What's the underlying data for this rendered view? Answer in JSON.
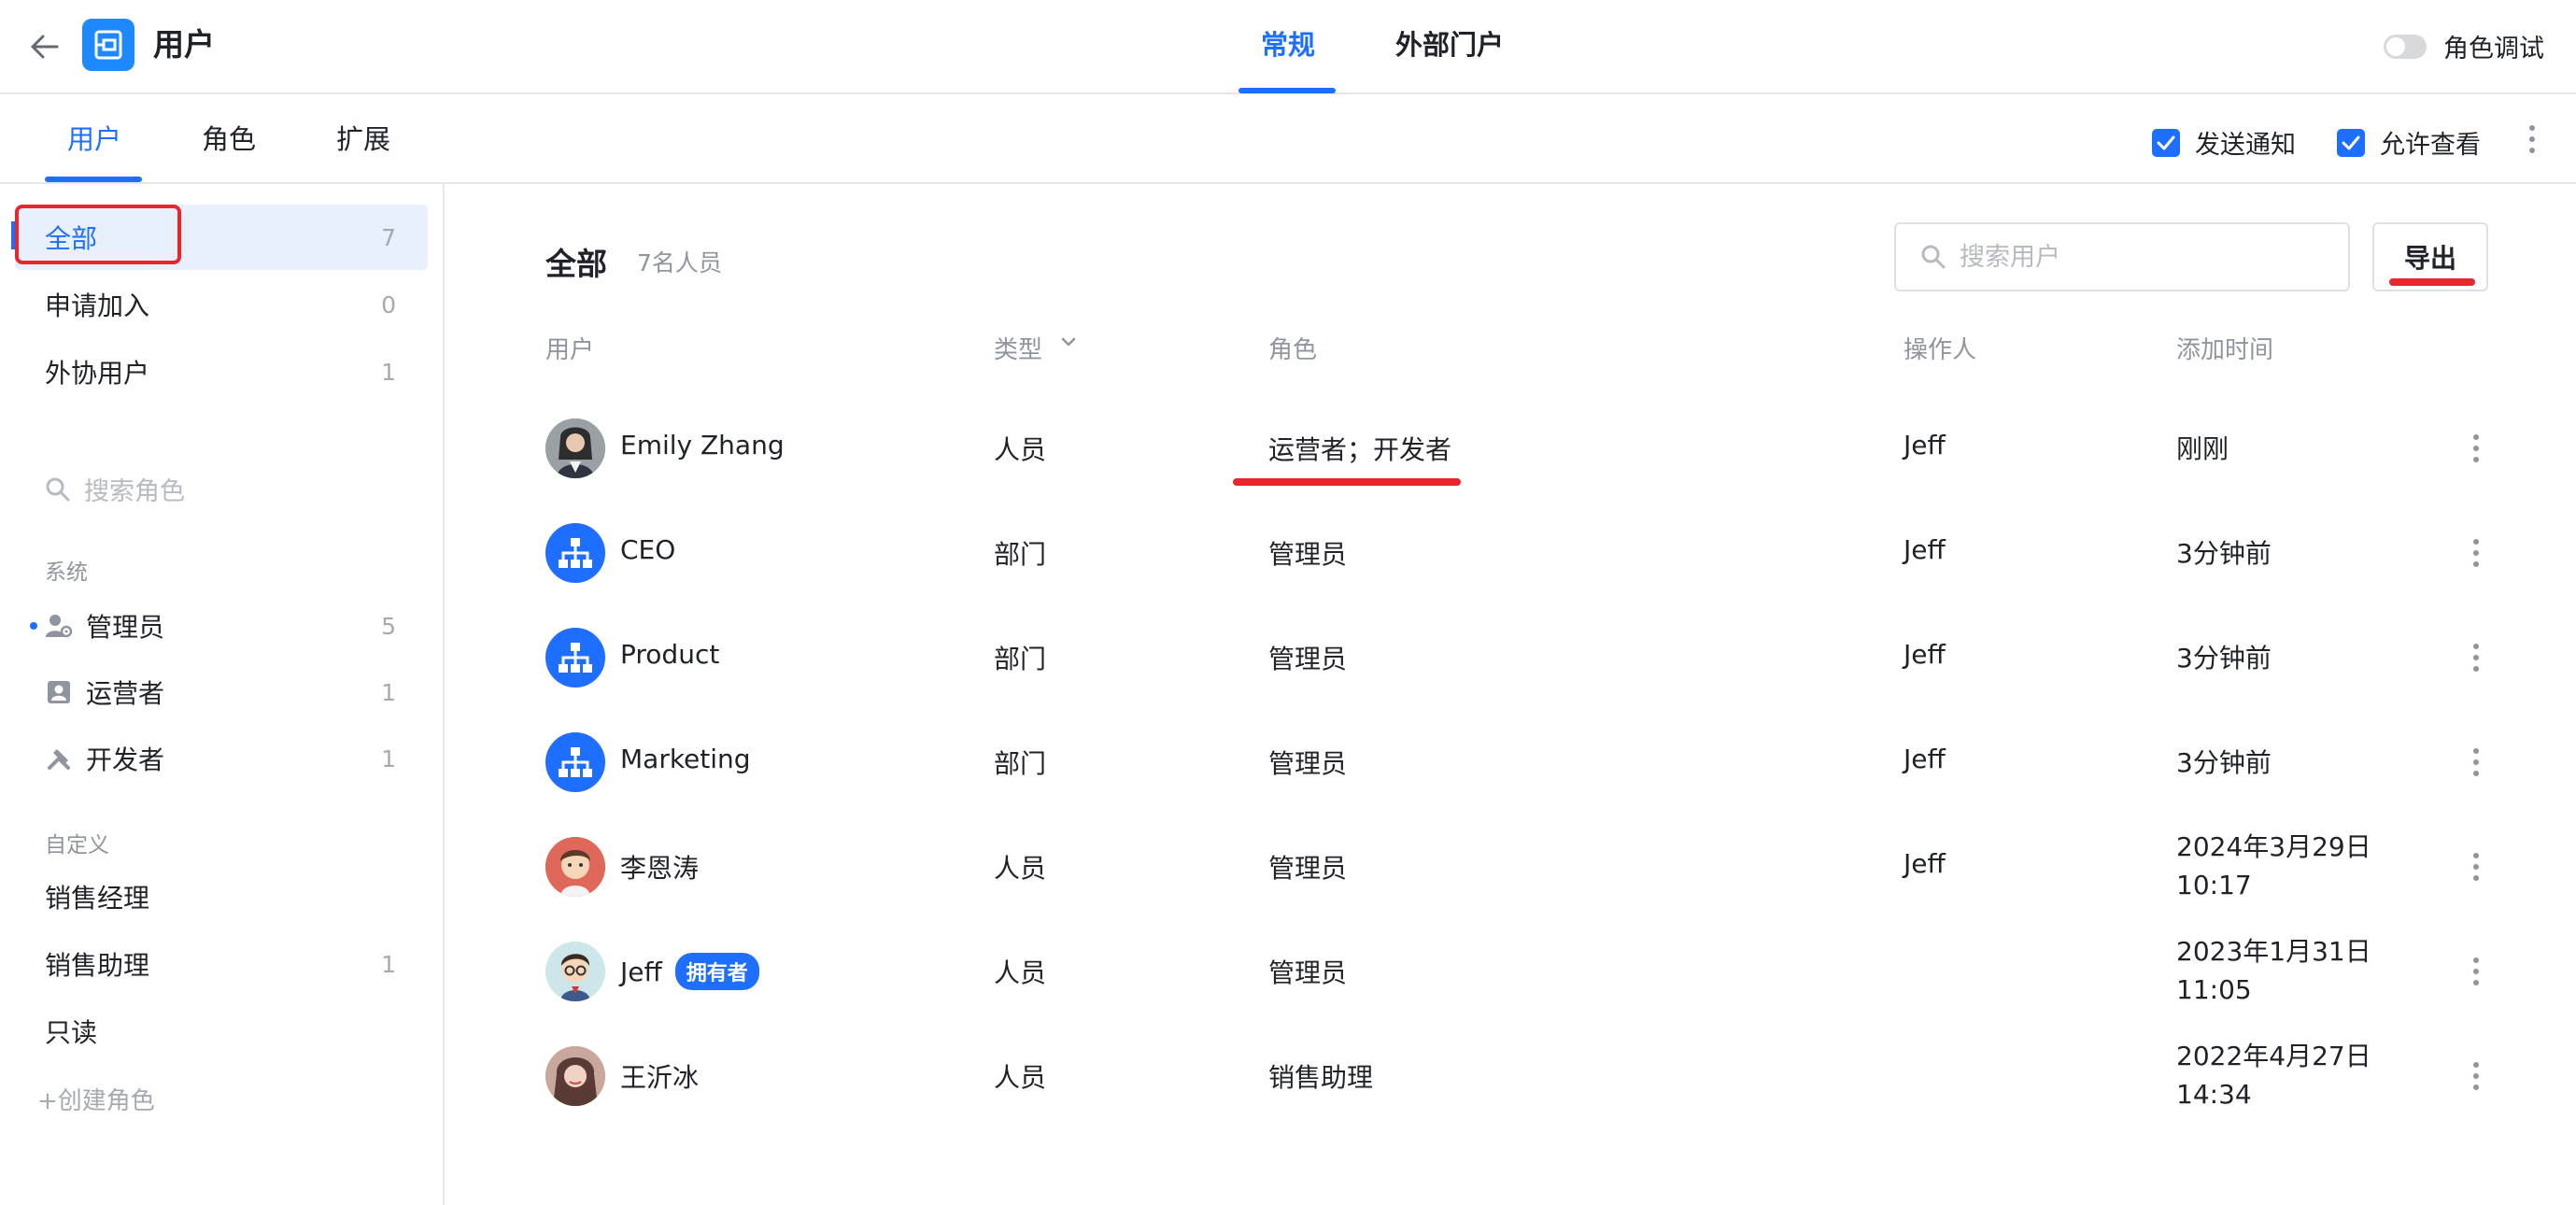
{
  "header": {
    "app_title": "用户",
    "tabs": [
      {
        "label": "常规",
        "active": true
      },
      {
        "label": "外部门户",
        "active": false
      }
    ],
    "role_debug_label": "角色调试",
    "role_debug_on": false
  },
  "subnav": {
    "tabs": [
      {
        "label": "用户",
        "active": true
      },
      {
        "label": "角色",
        "active": false
      },
      {
        "label": "扩展",
        "active": false
      }
    ],
    "send_notify_label": "发送通知",
    "send_notify_checked": true,
    "allow_view_label": "允许查看",
    "allow_view_checked": true
  },
  "sidebar": {
    "groups": [
      {
        "label": "全部",
        "count": "7",
        "active": true
      },
      {
        "label": "申请加入",
        "count": "0"
      },
      {
        "label": "外协用户",
        "count": "1"
      }
    ],
    "search_placeholder": "搜索角色",
    "system_section": "系统",
    "system_roles": [
      {
        "label": "管理员",
        "count": "5",
        "icon": "admin-icon"
      },
      {
        "label": "运营者",
        "count": "1",
        "icon": "operator-icon"
      },
      {
        "label": "开发者",
        "count": "1",
        "icon": "tools-icon"
      }
    ],
    "custom_section": "自定义",
    "custom_roles": [
      {
        "label": "销售经理",
        "count": ""
      },
      {
        "label": "销售助理",
        "count": "1"
      },
      {
        "label": "只读",
        "count": ""
      }
    ],
    "create_role_label": "+创建角色"
  },
  "main": {
    "title": "全部",
    "count": "7名人员",
    "search_placeholder": "搜索用户",
    "export_label": "导出",
    "columns": {
      "user": "用户",
      "type": "类型",
      "role": "角色",
      "operator": "操作人",
      "added": "添加时间"
    },
    "rows": [
      {
        "name": "Emily Zhang",
        "badge": "",
        "avatar": "photo-avatar",
        "type": "人员",
        "role": "运营者；开发者",
        "operator": "Jeff",
        "time1": "刚刚",
        "time2": ""
      },
      {
        "name": "CEO",
        "badge": "",
        "avatar": "department-icon",
        "type": "部门",
        "role": "管理员",
        "operator": "Jeff",
        "time1": "3分钟前",
        "time2": ""
      },
      {
        "name": "Product",
        "badge": "",
        "avatar": "department-icon",
        "type": "部门",
        "role": "管理员",
        "operator": "Jeff",
        "time1": "3分钟前",
        "time2": ""
      },
      {
        "name": "Marketing",
        "badge": "",
        "avatar": "department-icon",
        "type": "部门",
        "role": "管理员",
        "operator": "Jeff",
        "time1": "3分钟前",
        "time2": ""
      },
      {
        "name": "李恩涛",
        "badge": "",
        "avatar": "cartoon-avatar",
        "type": "人员",
        "role": "管理员",
        "operator": "Jeff",
        "time1": "2024年3月29日",
        "time2": "10:17"
      },
      {
        "name": "Jeff",
        "badge": "拥有者",
        "avatar": "cartoon-avatar-glasses",
        "type": "人员",
        "role": "管理员",
        "operator": "",
        "time1": "2023年1月31日",
        "time2": "11:05"
      },
      {
        "name": "王沂冰",
        "badge": "",
        "avatar": "photo-avatar",
        "type": "人员",
        "role": "销售助理",
        "operator": "",
        "time1": "2022年4月27日",
        "time2": "14:34"
      }
    ]
  },
  "colors": {
    "accent": "#1e6fff",
    "annotation_red": "#e8262d"
  }
}
